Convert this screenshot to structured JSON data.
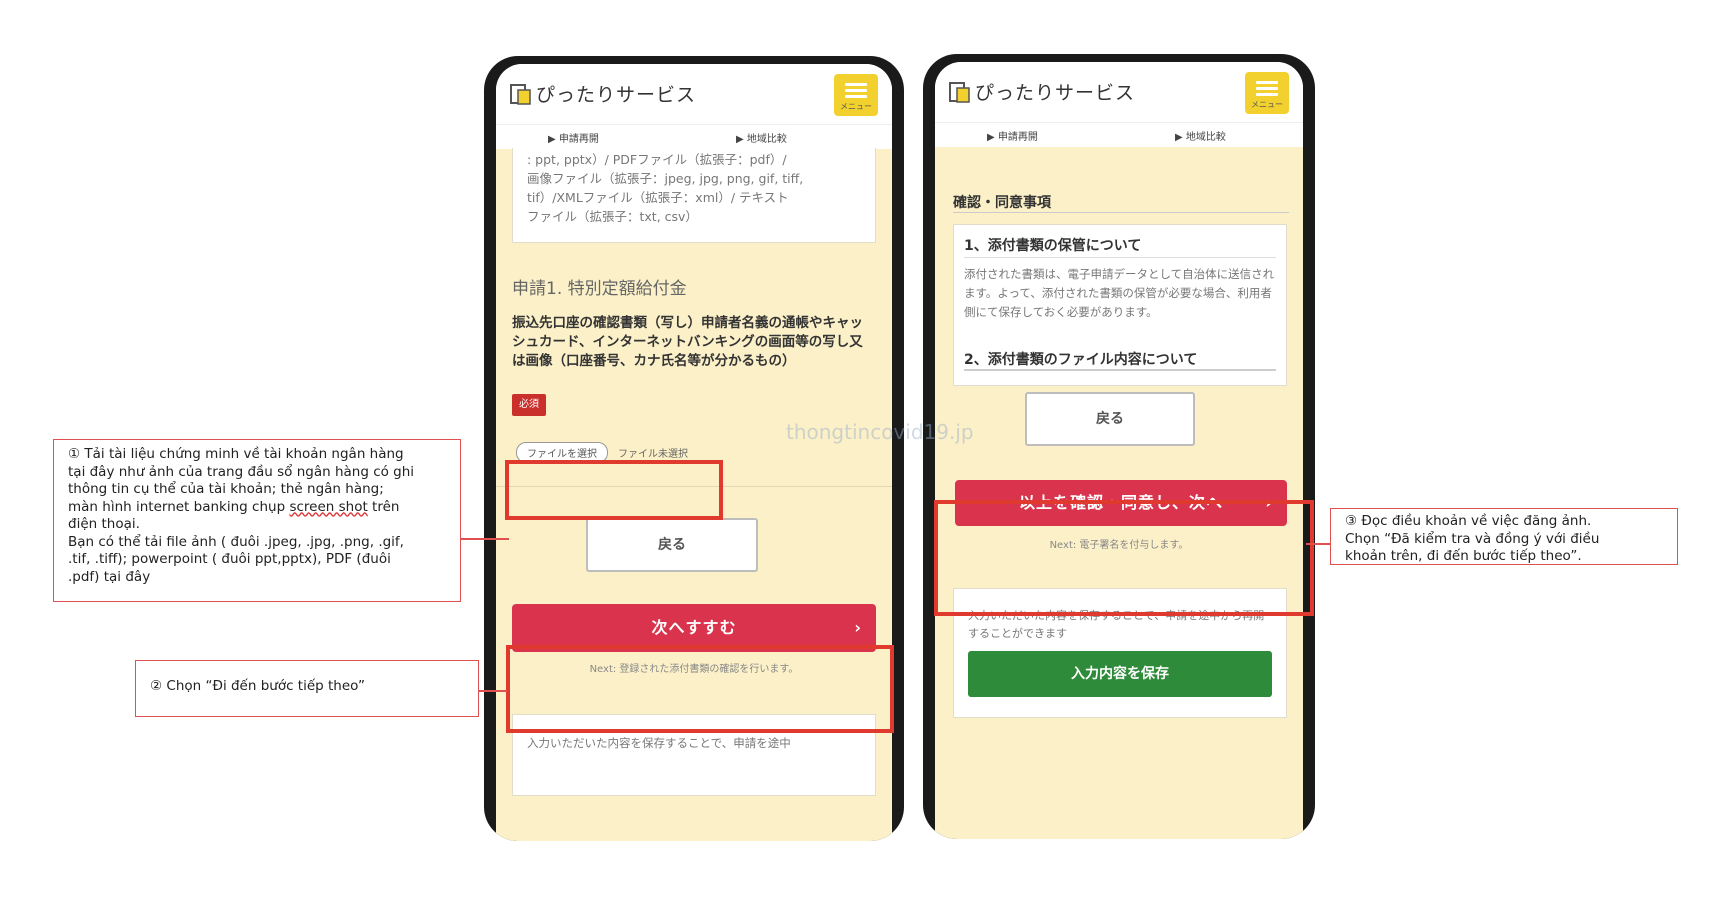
{
  "watermark": "thongtincovid19.jp",
  "phone_left": {
    "brand": "ぴったりサービス",
    "menu_label": "メニュー",
    "nav": [
      "▶ 申請再開",
      "▶ 地域比較"
    ],
    "file_types_text": [
      ": ppt, pptx）/ PDFファイル（拡張子：pdf）/",
      "画像ファイル（拡張子：jpeg, jpg, png, gif, tiff,",
      "tif）/XMLファイル（拡張子：xml）/ テキスト",
      "ファイル（拡張子：txt, csv）"
    ],
    "section_title": "申請1. 特別定額給付金",
    "field_label": "振込先口座の確認書類（写し）申請者名義の通帳やキャッシュカード、インターネットバンキングの画面等の写し又は画像（口座番号、カナ氏名等が分かるもの）",
    "required_badge": "必須",
    "file_button": "ファイルを選択",
    "file_status": "ファイル未選択",
    "back_button": "戻る",
    "next_button": "次へすすむ",
    "next_note": "Next: 登録された添付書類の確認を行います。",
    "save_note": "入力いただいた内容を保存することで、申請を途中"
  },
  "phone_right": {
    "brand": "ぴったりサービス",
    "menu_label": "メニュー",
    "nav": [
      "▶ 申請再開",
      "▶ 地域比較"
    ],
    "section_title": "確認・同意事項",
    "item1_title": "1、添付書類の保管について",
    "item1_body": "添付された書類は、電子申請データとして自治体に送信されます。よって、添付された書類の保管が必要な場合、利用者側にて保存しておく必要があります。",
    "item2_title": "2、添付書類のファイル内容について",
    "back_button": "戻る",
    "confirm_button": "以上を確認・同意し、次へ",
    "confirm_note": "Next: 電子署名を付与します。",
    "save_note": "入力いただいた内容を保存することで、申請を途中から再開することができます",
    "save_button": "入力内容を保存"
  },
  "annotations": {
    "a1": [
      "① Tải tài liệu chứng minh về tài khoản ngân hàng",
      "tại đây như ảnh của trang đầu sổ ngân hàng có ghi",
      "thông tin cụ thể của tài khoản; thẻ ngân hàng;",
      "màn hình internet banking chụp ",
      "screen shot",
      " trên",
      "điện thoại.",
      "Bạn có thể tải file ảnh ( đuôi .jpeg, .jpg, .png, .gif,",
      ".tif, .tiff); powerpoint ( đuôi ppt,pptx), PDF (đuôi",
      ".pdf) tại đây"
    ],
    "a2": "② Chọn “Đi đến bước tiếp theo”",
    "a3": [
      "③ Đọc điều khoản về việc đăng ảnh.",
      "Chọn “Đã kiểm tra và đồng ý với điều",
      "khoản trên, đi đến bước tiếp theo”."
    ]
  },
  "colors": {
    "primary": "#d9334d",
    "save": "#2e8b3a",
    "menu": "#f2d12e",
    "frame": "#e03a2f",
    "screen_bg": "#fbf0c8"
  }
}
